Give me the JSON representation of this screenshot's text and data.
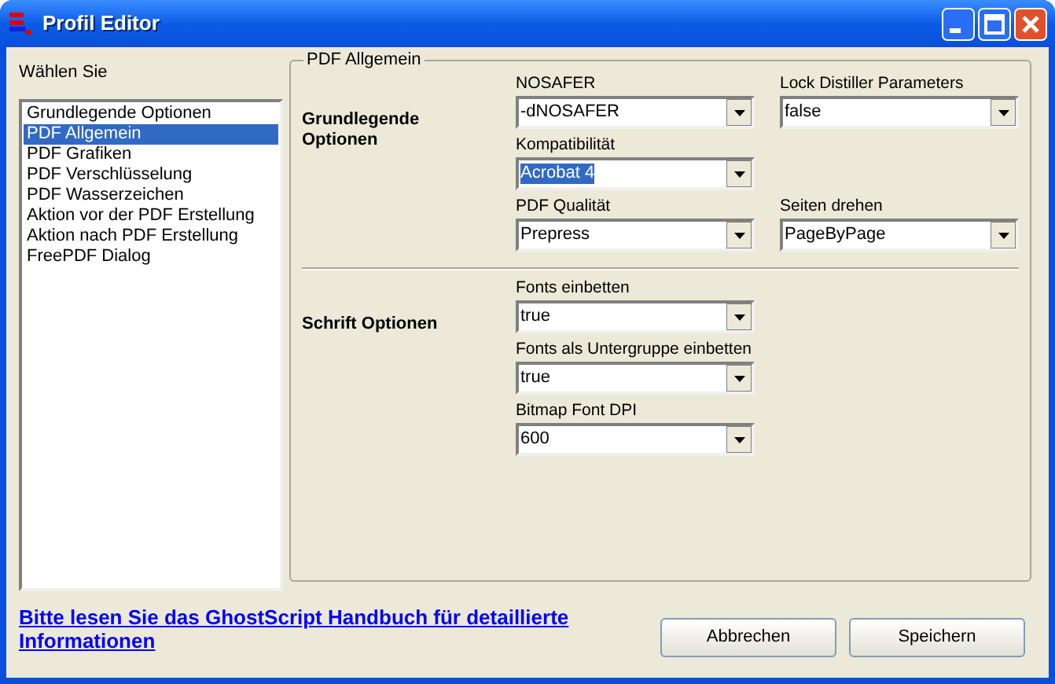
{
  "window": {
    "title": "Profil Editor"
  },
  "left": {
    "label": "Wählen Sie",
    "items": [
      {
        "label": "Grundlegende Optionen",
        "selected": false
      },
      {
        "label": "PDF Allgemein",
        "selected": true
      },
      {
        "label": "PDF Grafiken",
        "selected": false
      },
      {
        "label": "PDF Verschlüsselung",
        "selected": false
      },
      {
        "label": "PDF Wasserzeichen",
        "selected": false
      },
      {
        "label": "Aktion vor der PDF Erstellung",
        "selected": false
      },
      {
        "label": "Aktion nach PDF Erstellung",
        "selected": false
      },
      {
        "label": "FreePDF Dialog",
        "selected": false
      }
    ]
  },
  "group": {
    "title": "PDF Allgemein",
    "sections": [
      {
        "title": "Grundlegende Optionen",
        "rows": [
          [
            {
              "label": "NOSAFER",
              "value": "-dNOSAFER",
              "focused": false
            },
            {
              "label": "Lock Distiller Parameters",
              "value": "false",
              "focused": false
            }
          ],
          [
            {
              "label": "Kompatibilität",
              "value": "Acrobat 4",
              "focused": true
            }
          ],
          [
            {
              "label": "PDF Qualität",
              "value": "Prepress",
              "focused": false
            },
            {
              "label": "Seiten drehen",
              "value": "PageByPage",
              "focused": false
            }
          ]
        ]
      },
      {
        "title": "Schrift Optionen",
        "rows": [
          [
            {
              "label": "Fonts einbetten",
              "value": "true",
              "focused": false
            }
          ],
          [
            {
              "label": "Fonts als Untergruppe einbetten",
              "value": "true",
              "focused": false
            }
          ],
          [
            {
              "label": "Bitmap Font DPI",
              "value": "600",
              "focused": false
            }
          ]
        ]
      }
    ]
  },
  "link": "Bitte lesen Sie das GhostScript Handbuch für detaillierte Informationen",
  "buttons": [
    "Abbrechen",
    "Speichern"
  ]
}
